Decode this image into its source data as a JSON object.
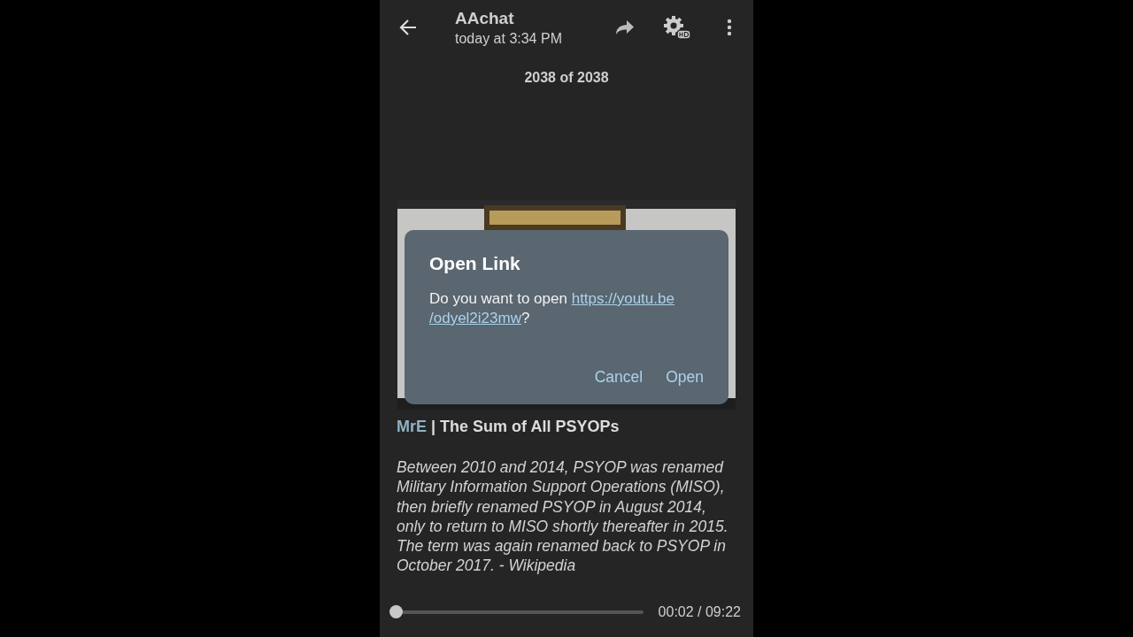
{
  "header": {
    "title": "AAchat",
    "subtitle": "today at 3:34 PM"
  },
  "counter": "2038 of 2038",
  "caption": {
    "author": "MrE",
    "title": "| The Sum of All PSYOPs"
  },
  "description": "Between 2010 and 2014, PSYOP was renamed Military Information Support Operations (MISO), then briefly renamed PSYOP in August 2014, only to return to MISO shortly thereafter in 2015. The term was again renamed back to PSYOP in October 2017. - Wikipedia",
  "player": {
    "level": 0.004,
    "time": "00:02 / 09:22"
  },
  "dialog": {
    "title": "Open Link",
    "message": "Do you want to open ",
    "link_lines": [
      "https://youtu.be",
      "/odyel2i23mw"
    ],
    "message_end": "?",
    "buttons": [
      "Cancel",
      "Open"
    ]
  }
}
